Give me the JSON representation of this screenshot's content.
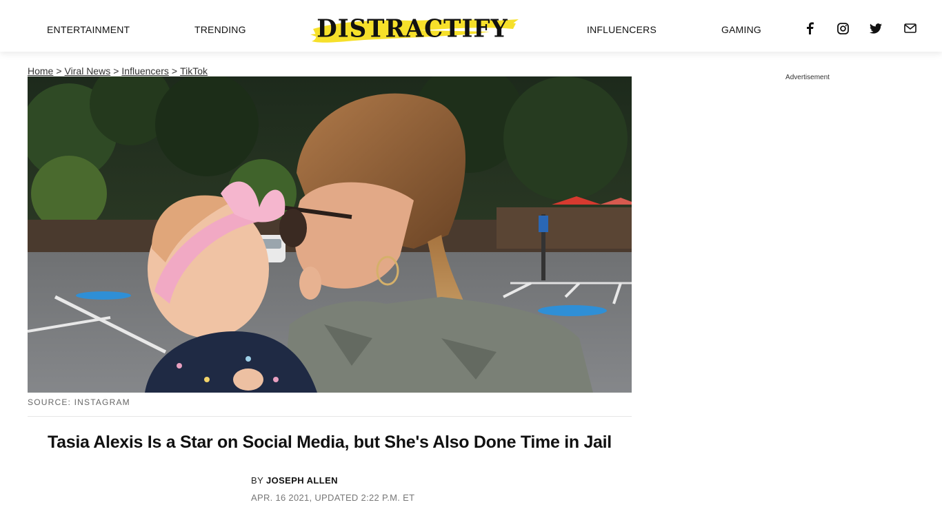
{
  "nav": {
    "left": [
      {
        "label": "ENTERTAINMENT"
      },
      {
        "label": "TRENDING"
      }
    ],
    "right": [
      {
        "label": "INFLUENCERS"
      },
      {
        "label": "GAMING"
      }
    ],
    "logo_text": "DISTRACTIFY",
    "social_icons": [
      "facebook-icon",
      "instagram-icon",
      "twitter-icon",
      "mail-icon"
    ]
  },
  "breadcrumb": {
    "items": [
      "Home",
      "Viral News",
      "Influencers",
      "TikTok"
    ],
    "separator": ">"
  },
  "hero": {
    "caption": "SOURCE: INSTAGRAM"
  },
  "article": {
    "title": "Tasia Alexis Is a Star on Social Media, but She's Also Done Time in Jail",
    "by_prefix": "BY",
    "author": "JOSEPH ALLEN",
    "date": "APR. 16 2021, UPDATED 2:22 P.M. ET"
  },
  "sidebar": {
    "ad_label": "Advertisement"
  },
  "colors": {
    "logo_swash": "#f6e02a",
    "text": "#111111",
    "muted": "#777777"
  }
}
